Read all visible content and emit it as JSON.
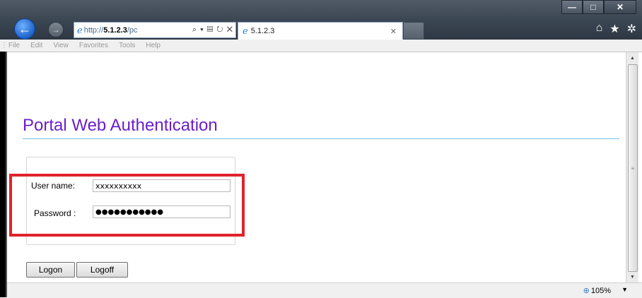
{
  "browser": {
    "address_url_prefix": "http://",
    "address_url_host": "5.1.2.3",
    "address_url_suffix": "/pc",
    "address_tools": "⌕ ▾ ▤ ↻ ✕",
    "tab_title": "5.1.2.3",
    "tab_close": "✕",
    "window_minimize": "—",
    "window_maximize": "□",
    "window_close": "✕",
    "back_icon": "←",
    "forward_icon": "→",
    "home_icon": "⌂",
    "star_icon": "★",
    "gear_icon": "✲"
  },
  "menubar": {
    "items": [
      "File",
      "Edit",
      "View",
      "Favorites",
      "Tools",
      "Help"
    ]
  },
  "page": {
    "title": "Portal Web Authentication",
    "username_label": "User name:",
    "username_value": "xxxxxxxxxx",
    "password_label": "Password :",
    "password_value": "●●●●●●●●●●●",
    "logon_button": "Logon",
    "logoff_button": "Logoff"
  },
  "status": {
    "zoom": "105%",
    "zoom_icon": "⊕",
    "zoom_dropdown": "▼"
  },
  "colors": {
    "title": "#6a1fc8",
    "divider": "#73c2e6",
    "highlight": "#e0232b"
  }
}
